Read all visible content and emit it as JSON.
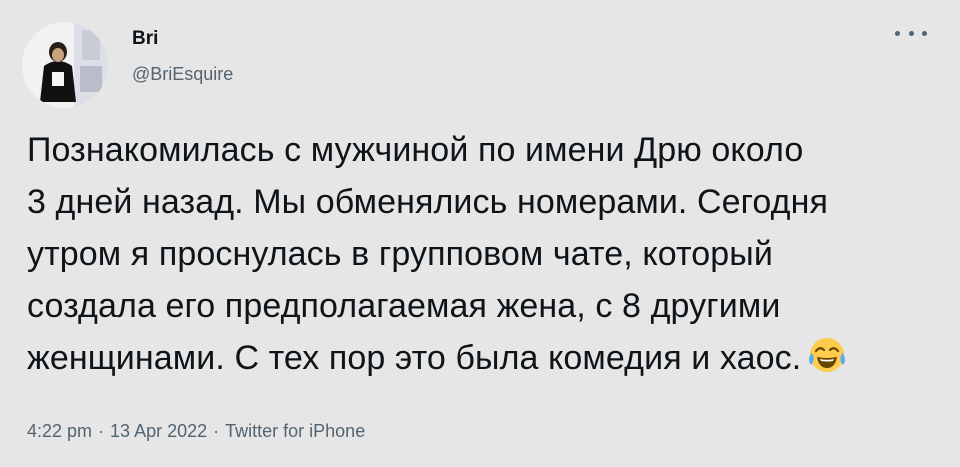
{
  "author": {
    "name": "Bri",
    "handle": "@BriEsquire",
    "avatar_icon": "profile-photo"
  },
  "more_icon": "more-horizontal-icon",
  "tweet": {
    "lines": [
      "Познакомилась с мужчиной по имени Дрю около",
      "3 дней назад. Мы обменялись номерами. Сегодня",
      "утром я проснулась в групповом чате, который",
      "создала его предполагаемая жена, с 8 другими",
      "женщинами. С тех пор это была комедия и хаос."
    ],
    "emoji": "face-with-tears-of-joy"
  },
  "meta": {
    "time": "4:22 pm",
    "separator": "·",
    "date": "13 Apr 2022",
    "source": "Twitter for iPhone"
  },
  "colors": {
    "background": "#e6e6e6",
    "text": "#0f1419",
    "secondary": "#536471"
  }
}
